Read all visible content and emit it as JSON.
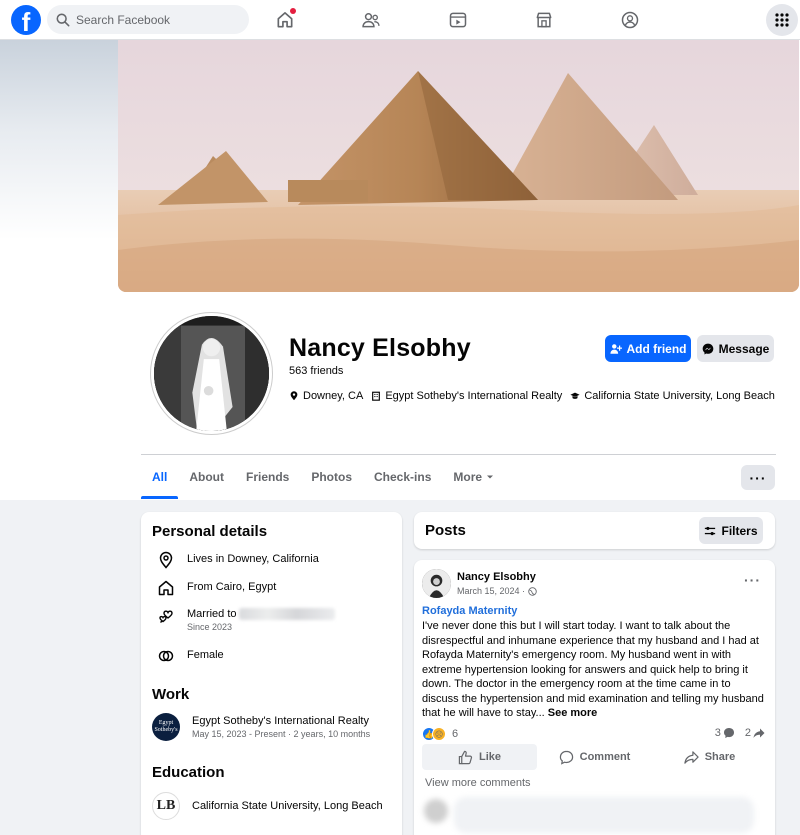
{
  "topbar": {
    "search_placeholder": "Search Facebook",
    "logo_letter": "f",
    "nav_icons": [
      "home-icon",
      "friends-icon",
      "video-icon",
      "marketplace-icon",
      "groups-icon"
    ],
    "menu_icon": "grid-menu-icon"
  },
  "profile": {
    "name": "Nancy Elsobhy",
    "friends": "563 friends",
    "location": "Downey, CA",
    "workplace": "Egypt Sotheby's International Realty",
    "school": "California State University, Long Beach",
    "add_friend_label": "Add friend",
    "message_label": "Message"
  },
  "tabs": [
    {
      "label": "All",
      "active": true
    },
    {
      "label": "About"
    },
    {
      "label": "Friends"
    },
    {
      "label": "Photos"
    },
    {
      "label": "Check-ins"
    },
    {
      "label": "More"
    }
  ],
  "personal_details": {
    "title": "Personal details",
    "lives_in": "Lives in Downey, California",
    "from": "From Cairo, Egypt",
    "married_prefix": "Married to",
    "married_since": "Since 2023",
    "gender": "Female"
  },
  "work": {
    "title": "Work",
    "employer": "Egypt Sotheby's International Realty",
    "logo_text": "Egypt Sotheby's",
    "period": "May 15, 2023 - Present · 2 years, 10 months"
  },
  "education": {
    "title": "Education",
    "school": "California State University, Long Beach",
    "logo_text": "LB"
  },
  "posts": {
    "title": "Posts",
    "filters_label": "Filters"
  },
  "post": {
    "author": "Nancy Elsobhy",
    "date": "March 15, 2024 ·",
    "tagged_page": "Rofayda Maternity",
    "body": "I've never done this but I will start today. I want to talk about the disrespectful and inhumane experience that my husband and I had at Rofayda Maternity's emergency room. My husband went in with extreme hypertension looking for answers and quick help to bring it down. The doctor in the emergency room at the time came in to discuss the hypertension and mid examination and telling my husband that he will have to stay...",
    "see_more": "See more",
    "reaction_count": "6",
    "comment_count": "3",
    "share_count": "2",
    "like_label": "Like",
    "comment_label": "Comment",
    "share_label": "Share",
    "view_more_comments": "View more comments"
  },
  "colors": {
    "brand": "#0866ff",
    "link": "#216fdb",
    "background": "#f0f2f5"
  }
}
